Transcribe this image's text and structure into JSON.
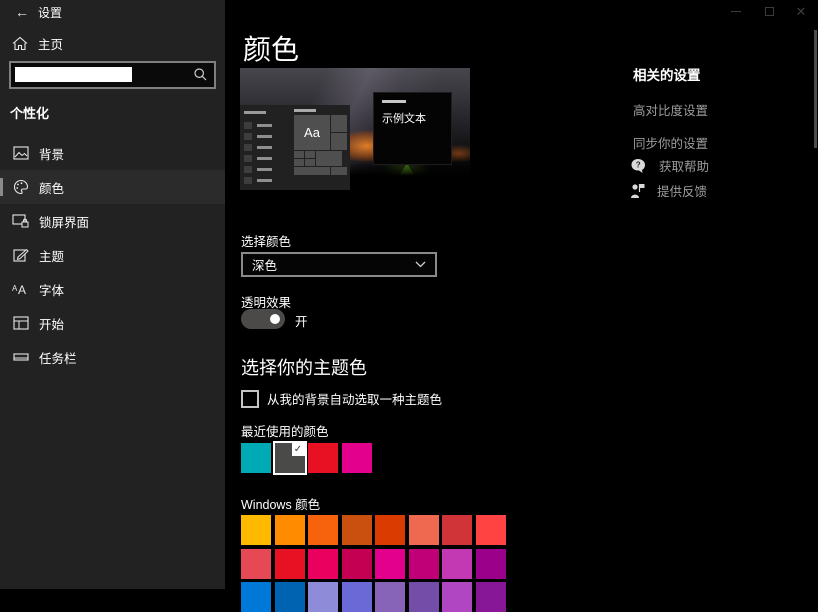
{
  "titlebar": {
    "app_title": "设置"
  },
  "sidebar": {
    "home_label": "主页",
    "section_header": "个性化",
    "items": [
      {
        "label": "背景",
        "icon": "background-image-icon"
      },
      {
        "label": "颜色",
        "icon": "colors-palette-icon",
        "selected": true
      },
      {
        "label": "锁屏界面",
        "icon": "lock-screen-icon"
      },
      {
        "label": "主题",
        "icon": "themes-icon"
      },
      {
        "label": "字体",
        "icon": "fonts-icon"
      },
      {
        "label": "开始",
        "icon": "start-icon"
      },
      {
        "label": "任务栏",
        "icon": "taskbar-icon"
      }
    ]
  },
  "content": {
    "page_title": "颜色",
    "preview": {
      "popup_sample_text": "示例文本",
      "tile_text": "Aa"
    },
    "color_mode": {
      "label": "选择颜色",
      "selected_value": "深色"
    },
    "transparency": {
      "label": "透明效果",
      "state_label": "开"
    },
    "accent": {
      "section_title": "选择你的主题色",
      "auto_checkbox_label": "从我的背景自动选取一种主题色",
      "recent_label": "最近使用的颜色",
      "recent_colors": [
        {
          "hex": "#00AAB5",
          "selected": false
        },
        {
          "hex": "#4A4A48",
          "selected": true
        },
        {
          "hex": "#E81123",
          "selected": false
        },
        {
          "hex": "#E3008C",
          "selected": false
        }
      ],
      "windows_label": "Windows 颜色",
      "windows_colors": [
        [
          "#FFB900",
          "#FF8C00",
          "#F7630C",
          "#CA5010",
          "#DA3B01",
          "#EF6950",
          "#D13438",
          "#FF4343"
        ],
        [
          "#E74856",
          "#E81123",
          "#EA005E",
          "#C30052",
          "#E3008C",
          "#BF0077",
          "#C239B3",
          "#9A0089"
        ],
        [
          "#0078D7",
          "#0063B1",
          "#8E8CD8",
          "#6B69D6",
          "#8764B8",
          "#744DA9",
          "#B146C2",
          "#881798"
        ]
      ]
    }
  },
  "related": {
    "header": "相关的设置",
    "links": [
      "高对比度设置",
      "同步你的设置"
    ],
    "help_links": [
      {
        "label": "获取帮助",
        "icon": "get-help-icon"
      },
      {
        "label": "提供反馈",
        "icon": "feedback-icon"
      }
    ]
  },
  "colors": {
    "accent": "#4A4A48",
    "sidebar_bg": "#222222",
    "content_bg": "#000000",
    "link_gray": "#9D9D9D"
  }
}
